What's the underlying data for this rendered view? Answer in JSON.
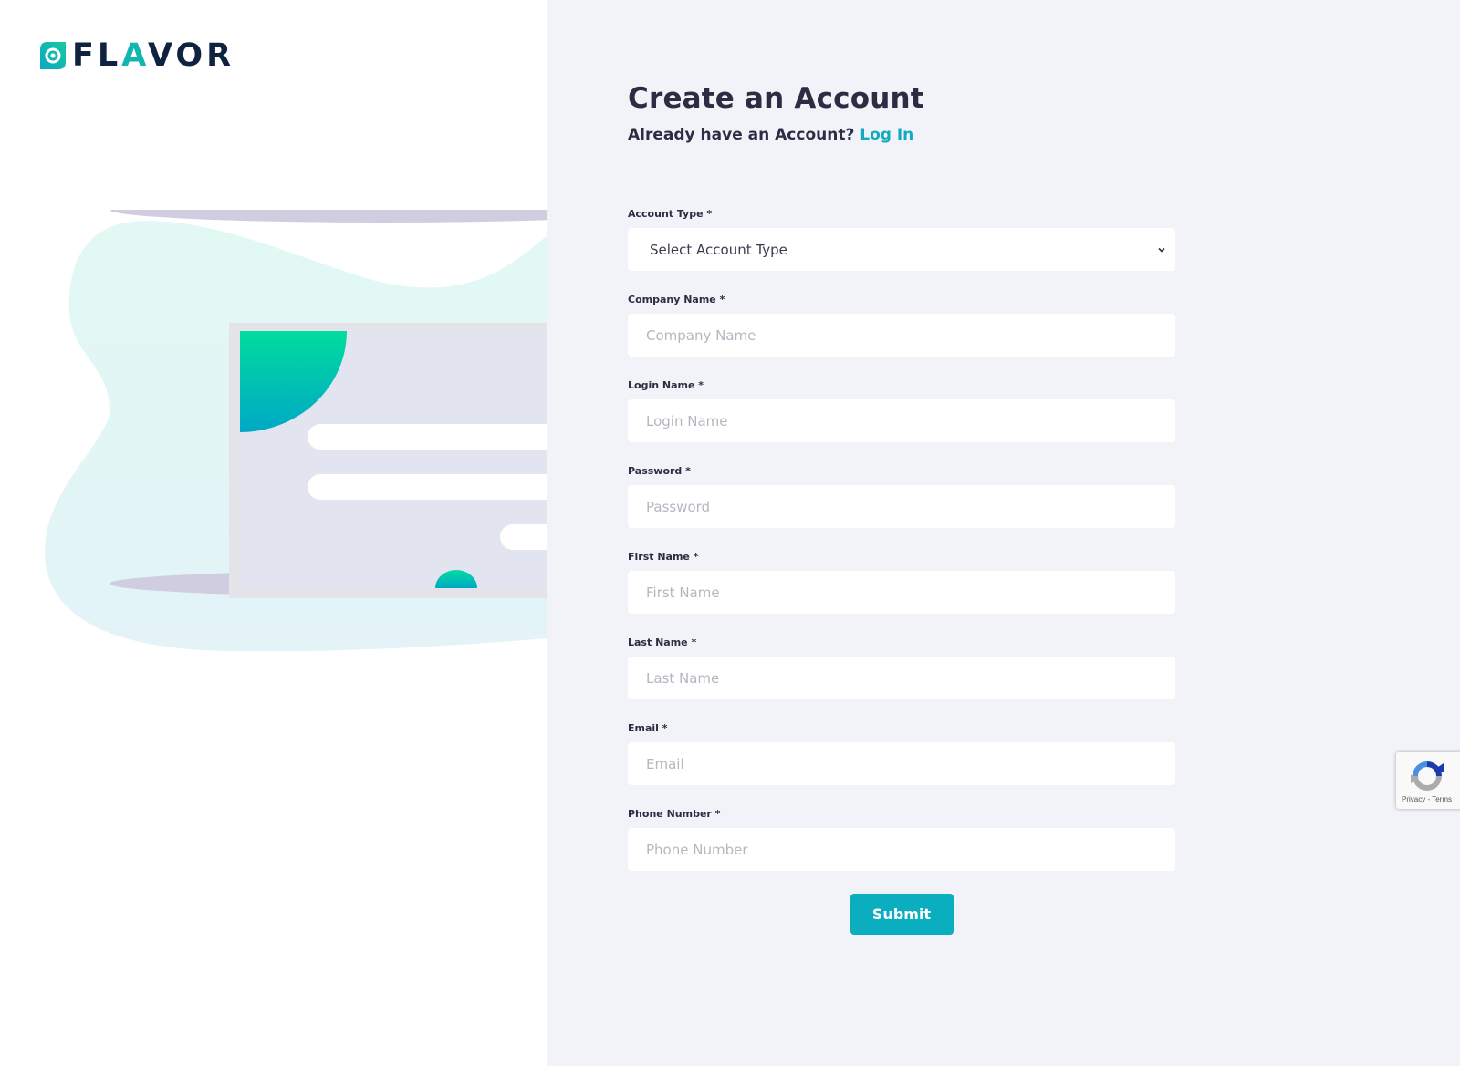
{
  "brand": {
    "name_prefix": "FL",
    "name_accent": "A",
    "name_suffix": "VOR",
    "primary_color": "#0f2240",
    "accent_color": "#12b5b0"
  },
  "header": {
    "title": "Create an Account",
    "subtitle_text": "Already have an Account?",
    "login_link": "Log In"
  },
  "form": {
    "account_type": {
      "label": "Account Type *",
      "selected": "Select Account Type"
    },
    "fields": [
      {
        "label": "Company Name *",
        "placeholder": "Company Name"
      },
      {
        "label": "Login Name *",
        "placeholder": "Login Name"
      },
      {
        "label": "Password *",
        "placeholder": "Password"
      },
      {
        "label": "First Name *",
        "placeholder": "First Name"
      },
      {
        "label": "Last Name *",
        "placeholder": "Last Name"
      },
      {
        "label": "Email *",
        "placeholder": "Email"
      },
      {
        "label": "Phone Number *",
        "placeholder": "Phone Number"
      }
    ],
    "submit_label": "Submit",
    "submit_color": "#0aaebf"
  },
  "recaptcha": {
    "privacy": "Privacy",
    "separator": " - ",
    "terms": "Terms"
  },
  "icons": {
    "logo": "flavor-logo-icon",
    "select_chevron": "chevron-down-icon",
    "recaptcha": "recaptcha-icon"
  }
}
